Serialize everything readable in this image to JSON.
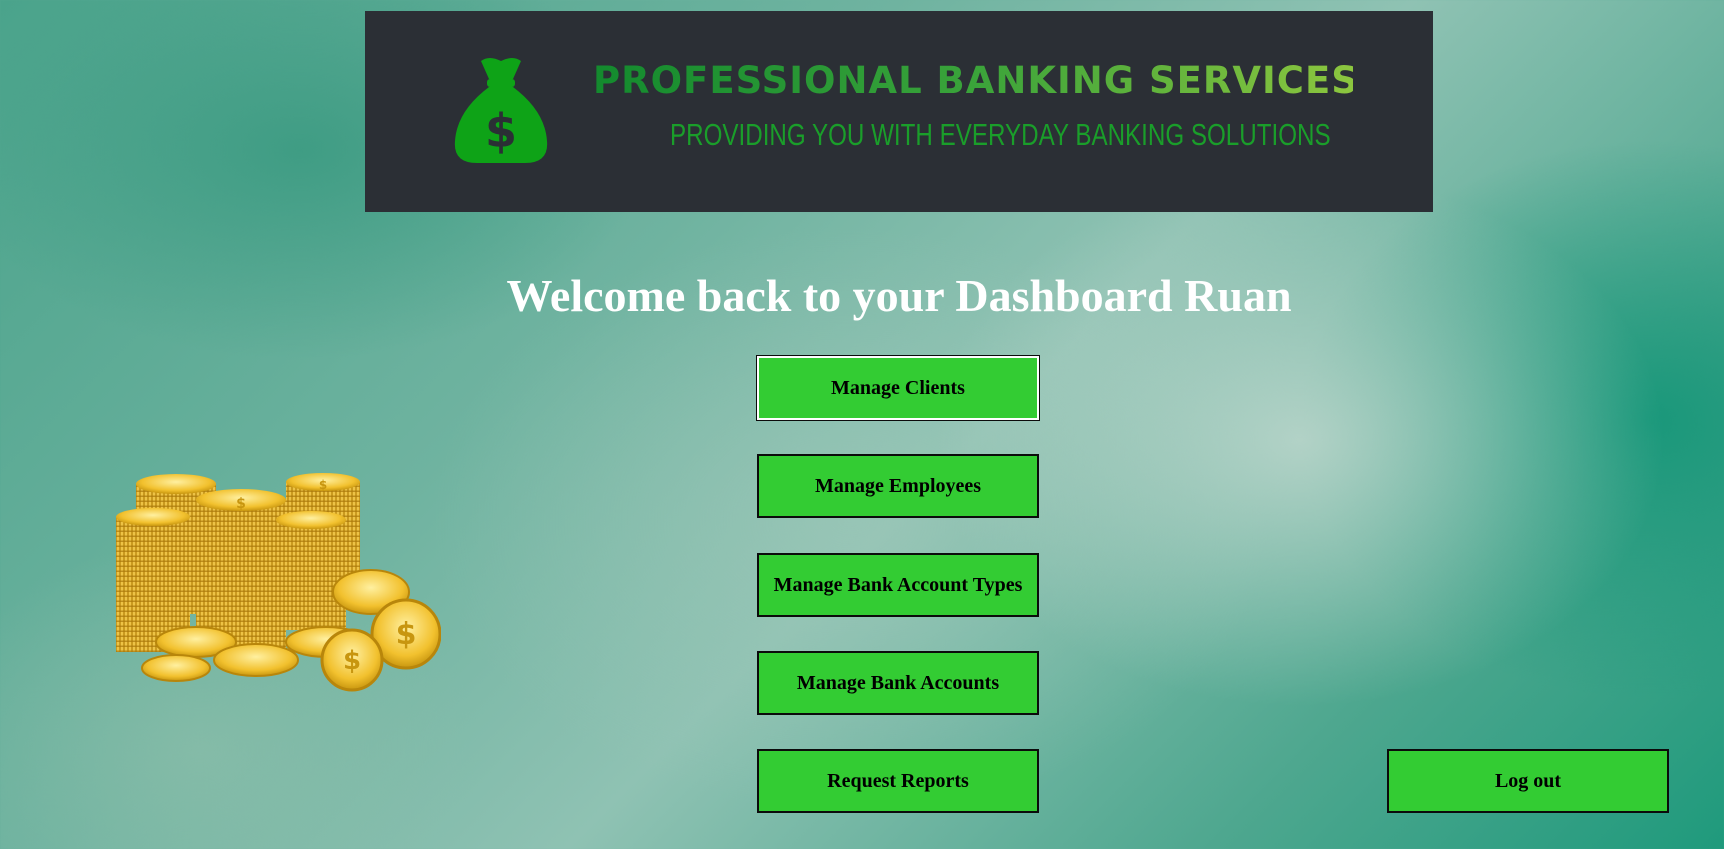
{
  "banner": {
    "title": "PROFESSIONAL BANKING SERVICES",
    "subtitle": "PROVIDING YOU WITH EVERYDAY BANKING SOLUTIONS",
    "logo_icon": "money-bag-icon",
    "colors": {
      "background": "#2b2f35",
      "accent_green": "#1a9e2a",
      "accent_lime": "#8cc63f"
    }
  },
  "welcome": {
    "text": "Welcome back to your Dashboard Ruan"
  },
  "menu": {
    "manage_clients": "Manage Clients",
    "manage_employees": "Manage Employees",
    "manage_account_types": "Manage Bank Account Types",
    "manage_bank_accounts": "Manage Bank Accounts",
    "request_reports": "Request Reports",
    "log_out": "Log out"
  },
  "illustration": {
    "name": "gold-coins-image"
  },
  "colors": {
    "button": "#33cc33",
    "button_border": "#0b0b0b",
    "heading": "#ffffff"
  }
}
